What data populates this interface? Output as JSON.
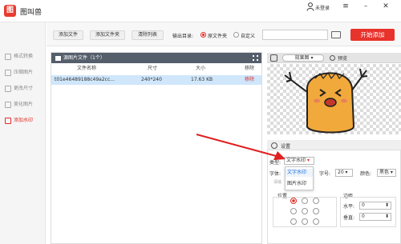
{
  "app": {
    "title": "图叫兽",
    "logo_text": "图"
  },
  "header": {
    "login_label": "未登录"
  },
  "sidebar": {
    "items": [
      {
        "label": "格式转换",
        "active": false
      },
      {
        "label": "压缩图片",
        "active": false
      },
      {
        "label": "更改尺寸",
        "active": false
      },
      {
        "label": "美化图片",
        "active": false
      },
      {
        "label": "添加水印",
        "active": true
      }
    ]
  },
  "toolbar": {
    "add_file": "添加文件",
    "add_folder": "添加文件夹",
    "clear_list": "清除列表",
    "output_label": "输出目录:",
    "option_original": "原文件夹",
    "option_custom": "自定义",
    "start": "开始添加"
  },
  "file_list": {
    "title": "源图片文件（1个）",
    "columns": [
      "文件名称",
      "尺寸",
      "大小",
      "移除"
    ],
    "rows": [
      {
        "name": "t01e46489188c49a2cc...",
        "size": "240*240",
        "filesize": "17.63 KB",
        "remove": "移除"
      }
    ]
  },
  "preview": {
    "effect": "效果图",
    "label": "预览"
  },
  "settings": {
    "title": "设置",
    "type_label": "类型:",
    "type_value": "文字水印",
    "options": [
      "文字水印",
      "图片水印"
    ],
    "font_label": "字体:",
    "font_placeholder": "请输",
    "size_label": "字号:",
    "size_value": "20",
    "color_label": "颜色:",
    "color_value": "黑色",
    "position_label": "位置",
    "margin_label": "边距",
    "h_label": "水平:",
    "h_value": "0",
    "v_label": "垂直:",
    "v_value": "0"
  },
  "colors": {
    "accent": "#e8322c",
    "row_selected": "#cfe6fb",
    "panel_header": "#555e6b",
    "character": "#f2a93b"
  }
}
